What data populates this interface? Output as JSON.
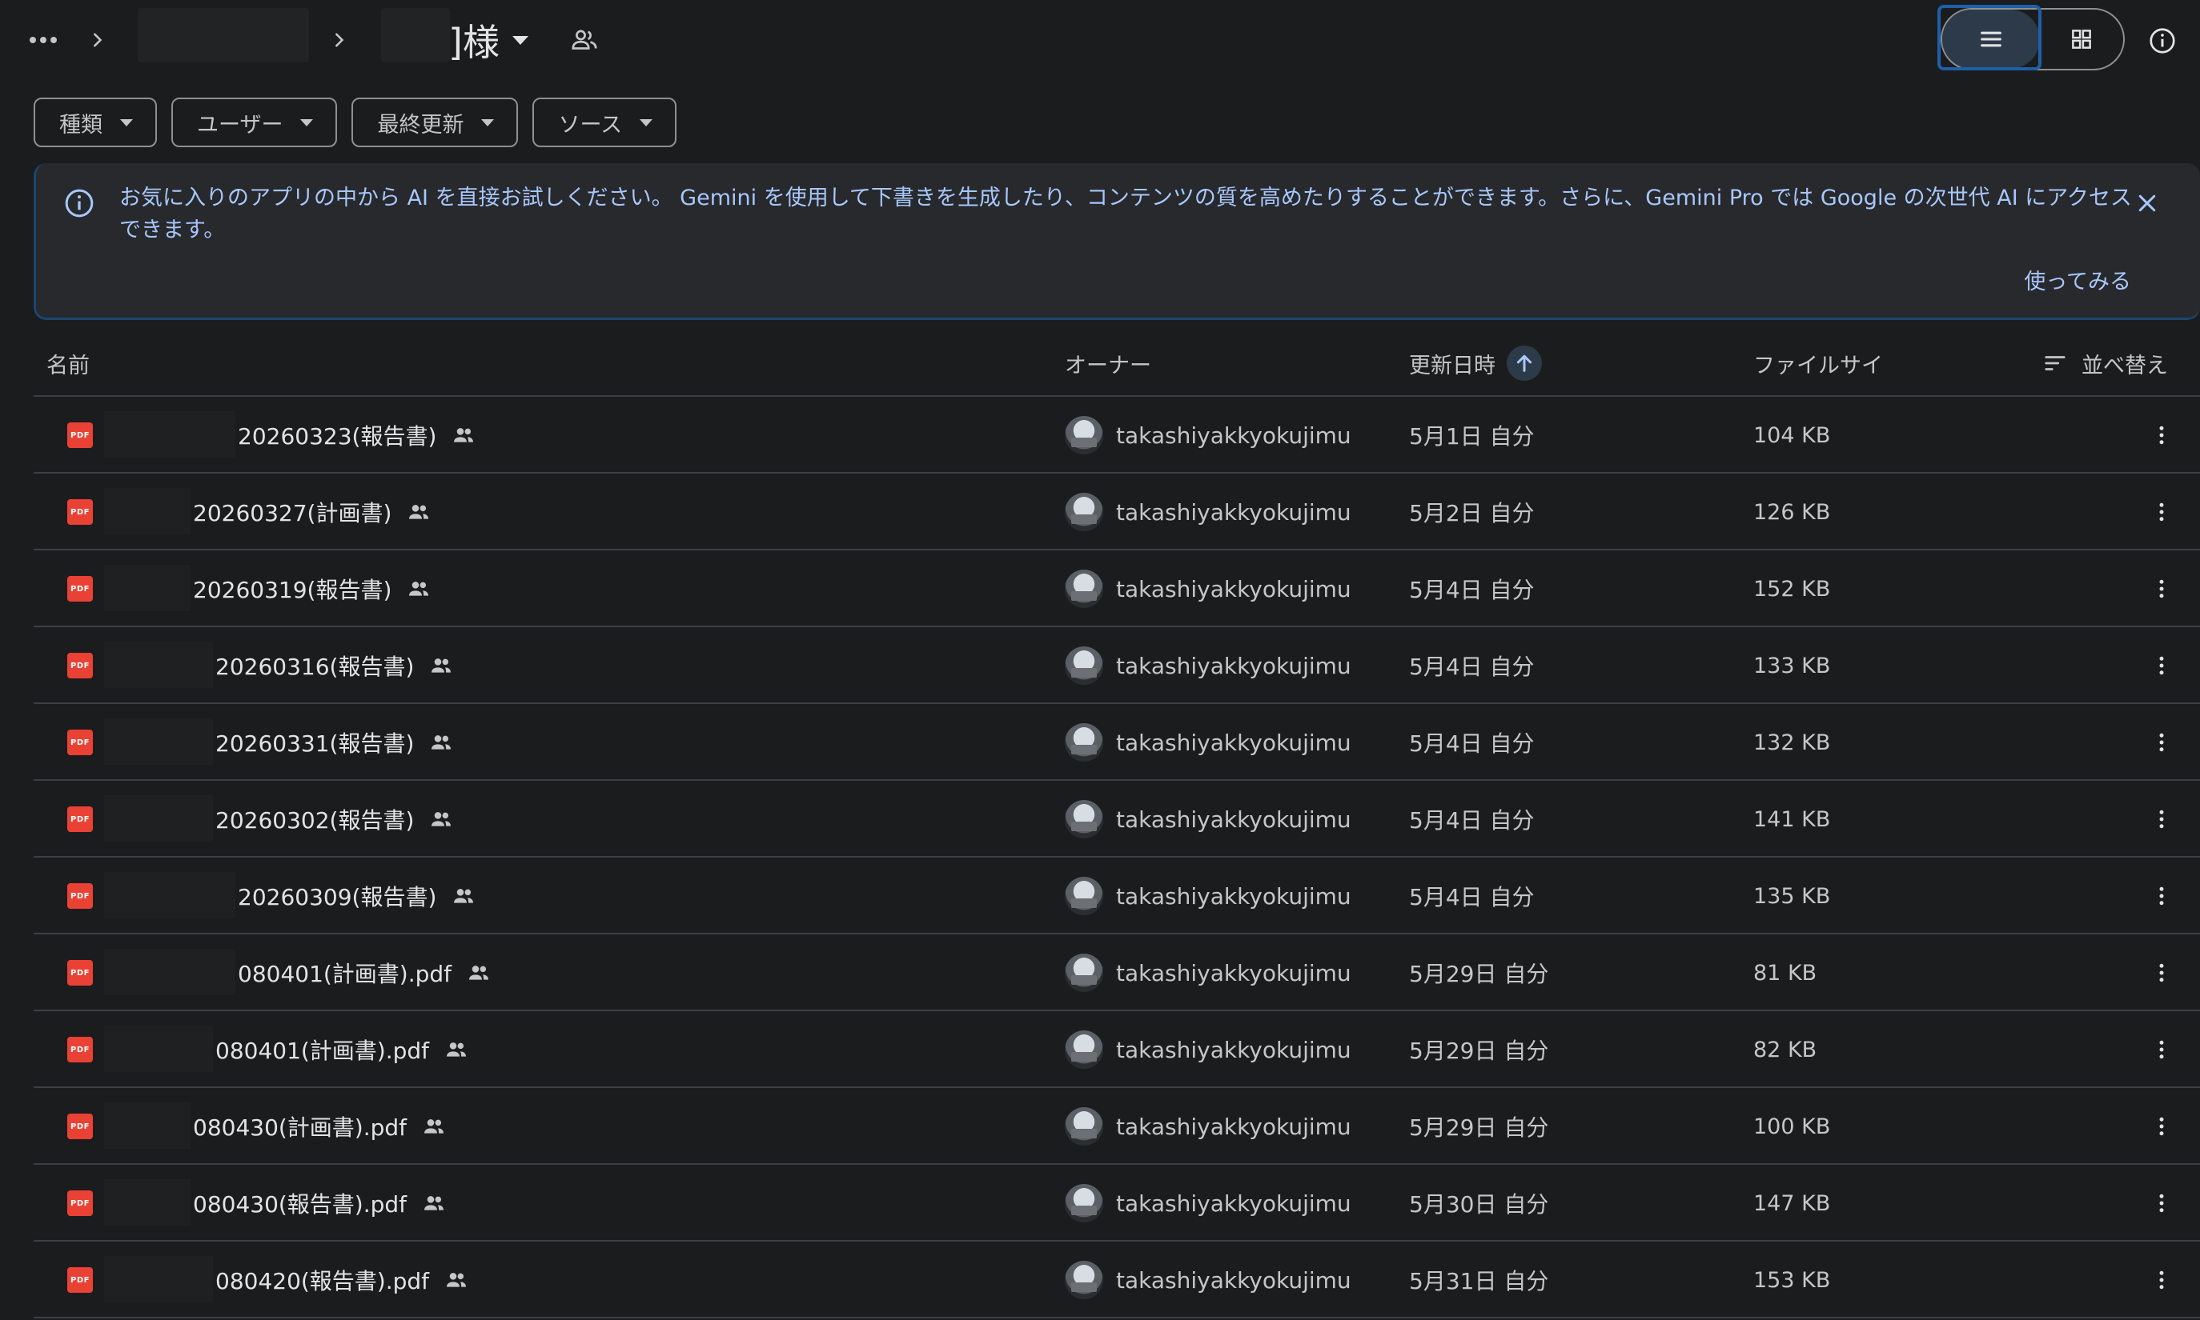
{
  "header": {
    "folder_title": "]様",
    "more_icon": "more-horiz-icon",
    "separator_icon": "chevron-right-icon"
  },
  "view_toggle": {
    "selected": "list",
    "list_icon": "list-view-icon",
    "grid_icon": "grid-view-icon"
  },
  "filters": [
    {
      "label": "種類"
    },
    {
      "label": "ユーザー"
    },
    {
      "label": "最終更新"
    },
    {
      "label": "ソース"
    }
  ],
  "banner": {
    "text": "お気に入りのアプリの中から AI を直接お試しください。 Gemini を使用して下書きを生成したり、コンテンツの質を高めたりすることができます。さらに、Gemini Pro では Google の次世代 AI にアクセスできます。",
    "action": "使ってみる"
  },
  "table": {
    "columns": {
      "name": "名前",
      "owner": "オーナー",
      "modified": "更新日時",
      "size": "ファイルサイ",
      "sort": "並べ替え"
    },
    "rows": [
      {
        "name": "20260323(報告書)",
        "owner": "takashiyakkyokujimu",
        "modified": "5月1日 自分",
        "size": "104 KB"
      },
      {
        "name": "20260327(計画書)",
        "owner": "takashiyakkyokujimu",
        "modified": "5月2日 自分",
        "size": "126 KB"
      },
      {
        "name": "20260319(報告書)",
        "owner": "takashiyakkyokujimu",
        "modified": "5月4日 自分",
        "size": "152 KB"
      },
      {
        "name": "20260316(報告書)",
        "owner": "takashiyakkyokujimu",
        "modified": "5月4日 自分",
        "size": "133 KB"
      },
      {
        "name": "20260331(報告書)",
        "owner": "takashiyakkyokujimu",
        "modified": "5月4日 自分",
        "size": "132 KB"
      },
      {
        "name": "20260302(報告書)",
        "owner": "takashiyakkyokujimu",
        "modified": "5月4日 自分",
        "size": "141 KB"
      },
      {
        "name": "20260309(報告書)",
        "owner": "takashiyakkyokujimu",
        "modified": "5月4日 自分",
        "size": "135 KB"
      },
      {
        "name": "080401(計画書).pdf",
        "owner": "takashiyakkyokujimu",
        "modified": "5月29日 自分",
        "size": "81 KB"
      },
      {
        "name": "080401(計画書).pdf",
        "owner": "takashiyakkyokujimu",
        "modified": "5月29日 自分",
        "size": "82 KB"
      },
      {
        "name": "080430(計画書).pdf",
        "owner": "takashiyakkyokujimu",
        "modified": "5月29日 自分",
        "size": "100 KB"
      },
      {
        "name": "080430(報告書).pdf",
        "owner": "takashiyakkyokujimu",
        "modified": "5月30日 自分",
        "size": "147 KB"
      },
      {
        "name": "080420(報告書).pdf",
        "owner": "takashiyakkyokujimu",
        "modified": "5月31日 自分",
        "size": "153 KB"
      }
    ]
  },
  "icons": {
    "file_type": "pdf-icon",
    "shared": "shared-people-icon",
    "row_menu": "more-vert-icon",
    "sort_direction": "arrow-up-icon"
  },
  "colors": {
    "background": "#1b1c1e",
    "accent": "#a8c7fa",
    "pdf_red": "#e94235",
    "banner_bg": "#27292d"
  }
}
